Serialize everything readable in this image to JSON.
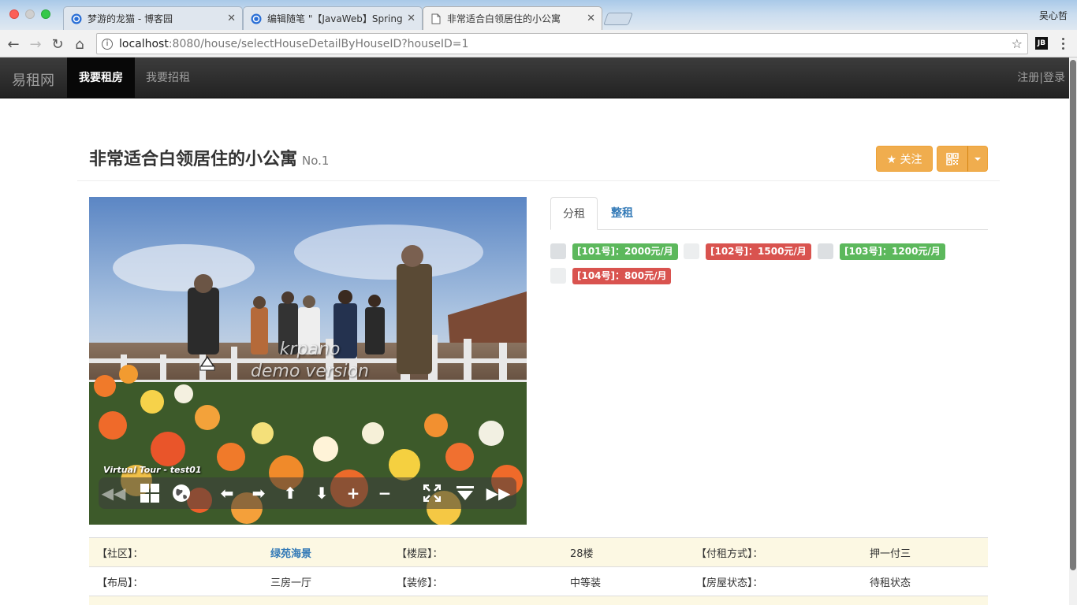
{
  "browser": {
    "tabs": [
      {
        "title": "梦游的龙猫 - 博客园",
        "icon": "cnblogs-icon"
      },
      {
        "title": "编辑随笔 \"【JavaWeb】Spring",
        "icon": "cnblogs-icon"
      },
      {
        "title": "非常适合白领居住的小公寓",
        "icon": "page-icon"
      }
    ],
    "user": "吴心哲",
    "url_host": "localhost",
    "url_path": ":8080/house/selectHouseDetailByHouseID?houseID=1",
    "ext_label": "JB"
  },
  "navbar": {
    "brand": "易租网",
    "items": [
      "我要租房",
      "我要招租"
    ],
    "right": "注册|登录"
  },
  "house": {
    "title": "非常适合白领居住的小公寓",
    "number": "No.1",
    "follow_label": "★ 关注"
  },
  "pano": {
    "watermark_line1": "krpano",
    "watermark_line2": "demo version",
    "label": "Virtual Tour - test01"
  },
  "tabs": [
    "分租",
    "整租"
  ],
  "rooms": [
    {
      "label": "[101号]：2000元/月",
      "color": "green"
    },
    {
      "label": "[102号]：1500元/月",
      "color": "red"
    },
    {
      "label": "[103号]：1200元/月",
      "color": "green"
    },
    {
      "label": "[104号]：800元/月",
      "color": "red"
    }
  ],
  "details": [
    [
      {
        "label": "【社区】：",
        "value": "绿苑海景",
        "link": true
      },
      {
        "label": "【楼层】：",
        "value": "28楼"
      },
      {
        "label": "【付租方式】：",
        "value": "押一付三"
      }
    ],
    [
      {
        "label": "【布局】：",
        "value": "三房一厅"
      },
      {
        "label": "【装修】：",
        "value": "中等装"
      },
      {
        "label": "【房屋状态】：",
        "value": "待租状态"
      }
    ]
  ],
  "colors": {
    "navbar": "#222222",
    "warning": "#f0ad4e",
    "success": "#5cb85c",
    "danger": "#d9534f",
    "link": "#337ab7"
  }
}
